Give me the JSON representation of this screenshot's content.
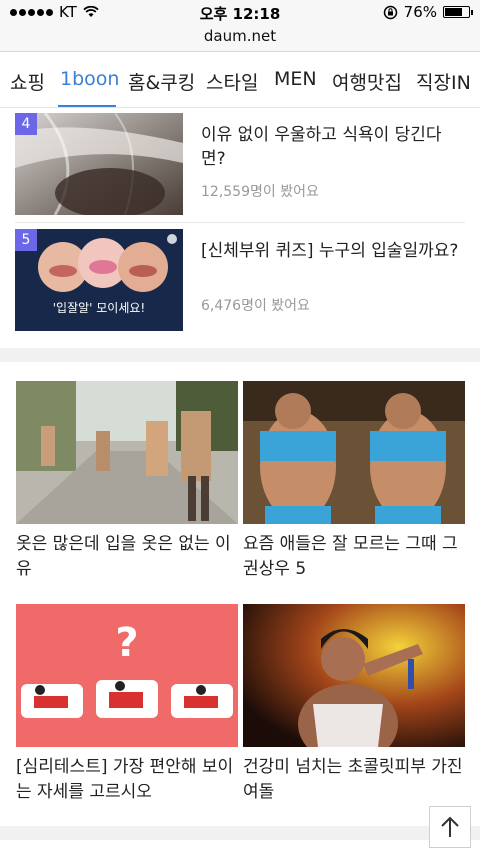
{
  "status": {
    "carrier": "KT",
    "time": "오후 12:18",
    "battery": "76%",
    "battery_level": 0.76
  },
  "url": "daum.net",
  "tabs": [
    {
      "label": "쇼핑"
    },
    {
      "label": "1boon",
      "active": true
    },
    {
      "label": "홈&쿠킹"
    },
    {
      "label": "스타일"
    },
    {
      "label": "MEN"
    },
    {
      "label": "여행맛집"
    },
    {
      "label": "직장IN"
    }
  ],
  "ranked": [
    {
      "rank": "4",
      "title": "이유 없이 우울하고 식욕이 당긴다면?",
      "views": "12,559명이 봤어요"
    },
    {
      "rank": "5",
      "title": "[신체부위 퀴즈] 누구의 입술일까요?",
      "views": "6,476명이 봤어요",
      "thumb_caption": "'입잘알' 모이세요!"
    }
  ],
  "cards": [
    {
      "title": "옷은 많은데 입을 옷은 없는 이유"
    },
    {
      "title": "요즘 애들은 잘 모르는 그때 그 권상우 5"
    },
    {
      "title": "[심리테스트] 가장 편안해 보이는 자세를 고르시오"
    },
    {
      "title": "건강미 넘치는 초콜릿피부 가진 여돌"
    }
  ],
  "colors": {
    "accent": "#3b7fd8",
    "badge": "#6b67e8"
  }
}
